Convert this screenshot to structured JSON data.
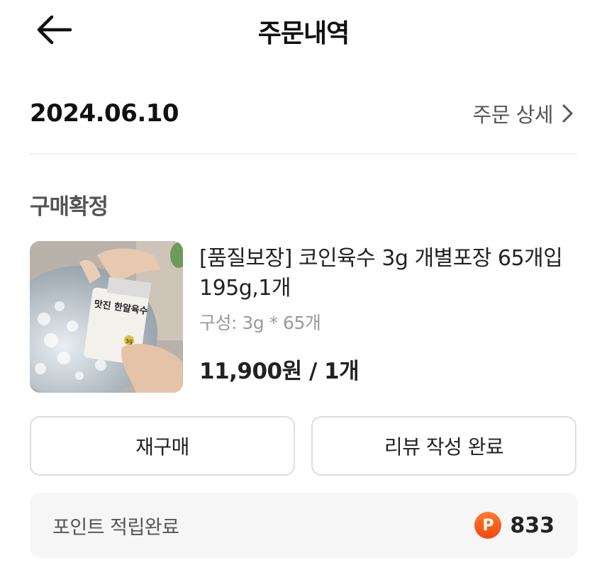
{
  "header": {
    "title": "주문내역",
    "back_icon": "arrow-left-icon"
  },
  "order": {
    "date": "2024.06.10",
    "detail_link": "주문 상세",
    "detail_icon": "chevron-right-icon",
    "status": "구매확정"
  },
  "product": {
    "name": "[품질보장] 코인육수 3g 개별포장 65개입 195g,1개",
    "option": "구성: 3g * 65개",
    "price": "11,900원 / 1개",
    "image_label": "맛진 한알육수",
    "image_sublabel": "3g"
  },
  "actions": {
    "rebuy_label": "재구매",
    "review_label": "리뷰 작성 완료"
  },
  "points": {
    "label": "포인트 적립완료",
    "badge": "P",
    "value": "833",
    "badge_color": "#f25a18"
  }
}
